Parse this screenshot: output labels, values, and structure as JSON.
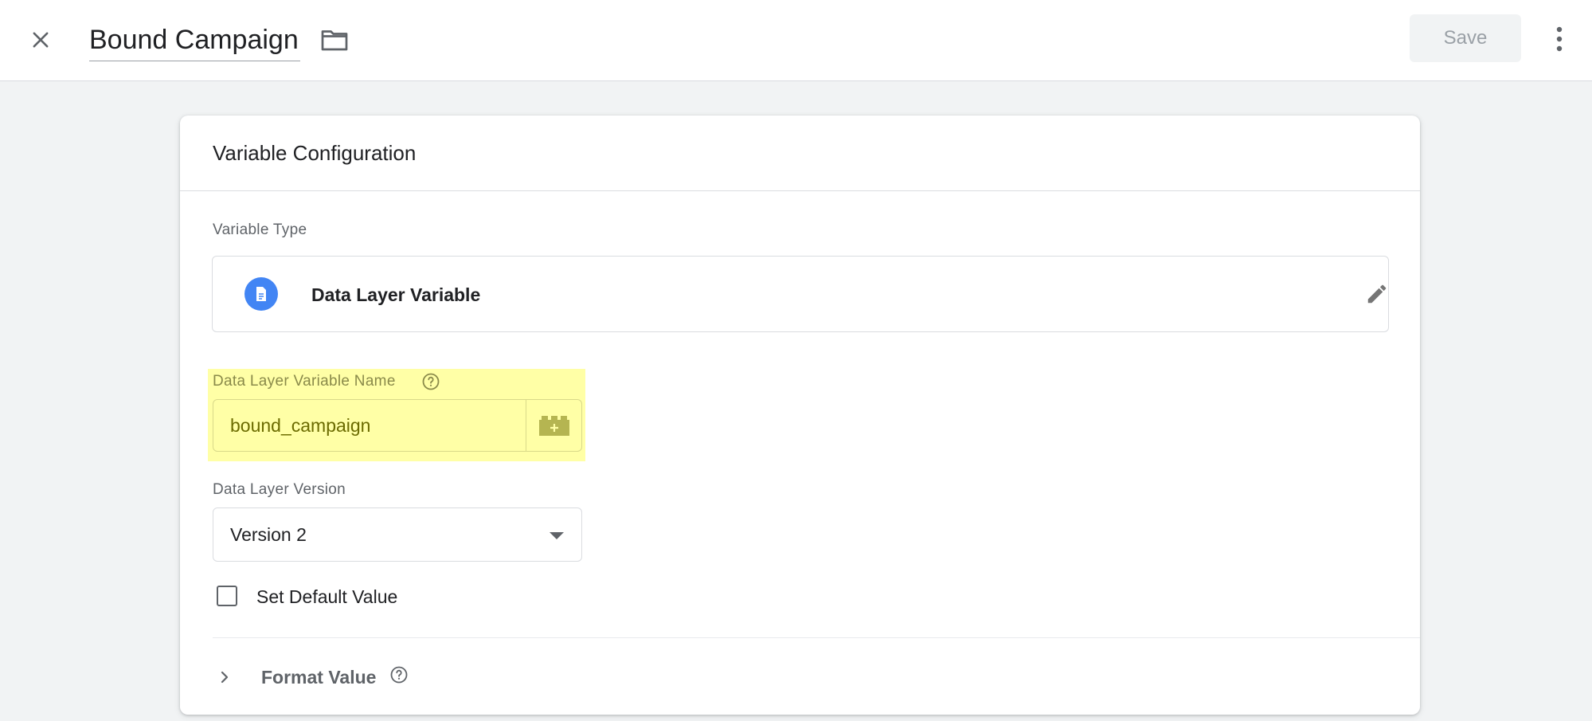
{
  "header": {
    "title": "Bound Campaign",
    "save_label": "Save",
    "close_icon": "close-icon",
    "folder_icon": "folder-icon",
    "more_icon": "more-vert-icon"
  },
  "card": {
    "title": "Variable Configuration",
    "variable_type": {
      "label": "Variable Type",
      "name": "Data Layer Variable",
      "icon": "document-icon",
      "edit_icon": "pencil-icon"
    },
    "variable_name": {
      "label": "Data Layer Variable Name",
      "value": "bound_campaign",
      "highlighted": true,
      "highlight_color": "#ffffa6"
    },
    "version": {
      "label": "Data Layer Version",
      "selected": "Version 2"
    },
    "default_value": {
      "label": "Set Default Value",
      "checked": false
    },
    "format_value": {
      "label": "Format Value",
      "expanded": false
    }
  },
  "colors": {
    "accent_blue": "#4285f4",
    "page_bg": "#f1f3f4",
    "highlight": "#ffffa6"
  }
}
